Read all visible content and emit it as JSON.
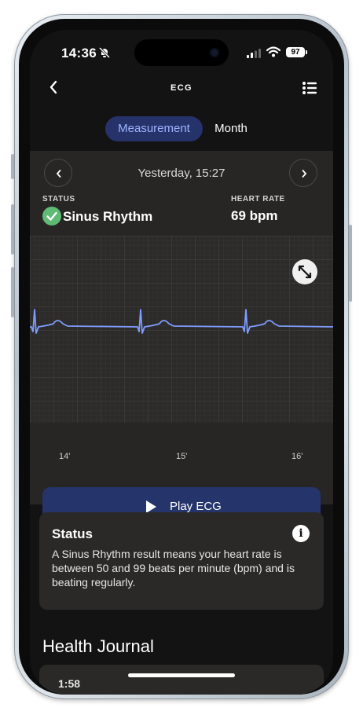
{
  "status_bar": {
    "time": "14:36",
    "battery": "97"
  },
  "nav": {
    "title": "ECG"
  },
  "tabs": [
    {
      "label": "Measurement",
      "selected": true
    },
    {
      "label": "Month",
      "selected": false
    }
  ],
  "recording": {
    "date": "Yesterday, 15:27",
    "status_label": "STATUS",
    "status_value": "Sinus Rhythm",
    "heart_rate_label": "HEART RATE",
    "heart_rate_value": "69 bpm",
    "time_ticks": [
      "14'",
      "15'",
      "16'"
    ]
  },
  "play_button": {
    "label": "Play ECG"
  },
  "status_card": {
    "title": "Status",
    "body": "A Sinus Rhythm result means your heart rate is between 50 and 99 beats per minute (bpm) and is beating regularly."
  },
  "health_journal": {
    "title": "Health Journal",
    "peek": "1:58"
  },
  "colors": {
    "accent": "#26336b",
    "ecg_line": "#7f9cff",
    "check": "#5fba74"
  }
}
